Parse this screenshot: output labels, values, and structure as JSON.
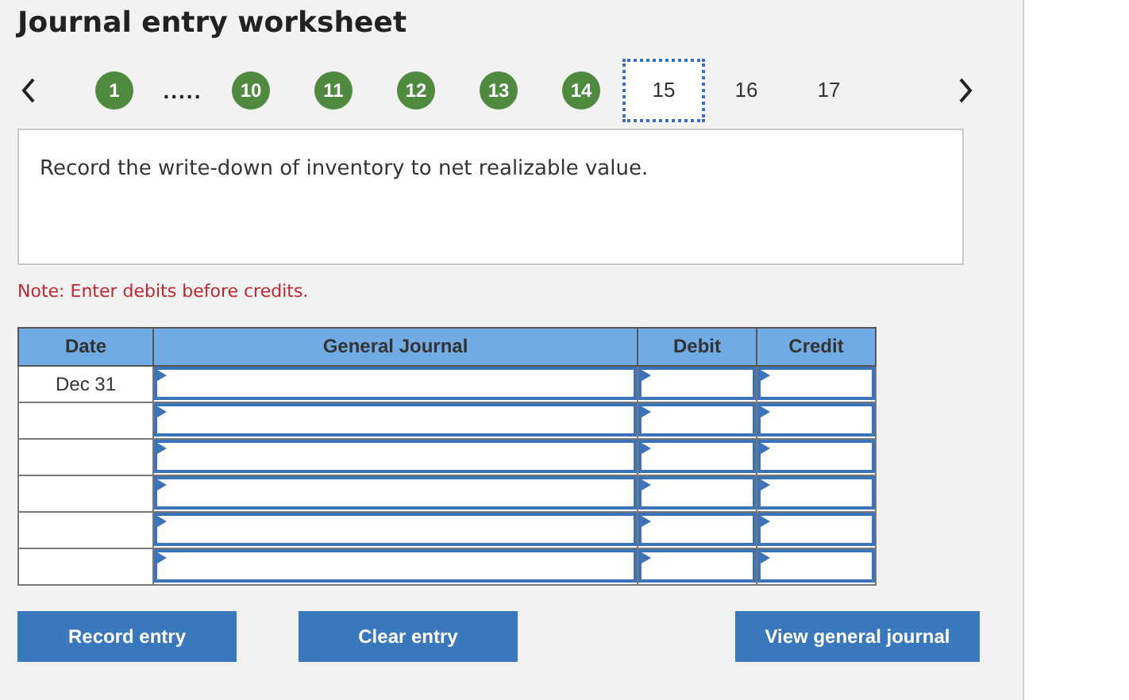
{
  "title": "Journal entry worksheet",
  "steps": [
    {
      "kind": "step",
      "label": "1",
      "completed": true,
      "selected": false
    },
    {
      "kind": "ellipsis",
      "label": "....."
    },
    {
      "kind": "step",
      "label": "10",
      "completed": true,
      "selected": false
    },
    {
      "kind": "step",
      "label": "11",
      "completed": true,
      "selected": false
    },
    {
      "kind": "step",
      "label": "12",
      "completed": true,
      "selected": false
    },
    {
      "kind": "step",
      "label": "13",
      "completed": true,
      "selected": false
    },
    {
      "kind": "step",
      "label": "14",
      "completed": true,
      "selected": false
    },
    {
      "kind": "step",
      "label": "15",
      "completed": false,
      "selected": true
    },
    {
      "kind": "step",
      "label": "16",
      "completed": false,
      "selected": false
    },
    {
      "kind": "step",
      "label": "17",
      "completed": false,
      "selected": false
    }
  ],
  "instruction": "Record the write-down of inventory to net realizable value.",
  "note": "Note: Enter debits before credits.",
  "table": {
    "columns": [
      "Date",
      "General Journal",
      "Debit",
      "Credit"
    ],
    "rows": [
      {
        "date": "Dec 31"
      },
      {},
      {},
      {},
      {},
      {}
    ]
  },
  "buttons": [
    {
      "label": "Record entry"
    },
    {
      "label": "Clear entry"
    },
    {
      "label": "View general journal"
    }
  ]
}
